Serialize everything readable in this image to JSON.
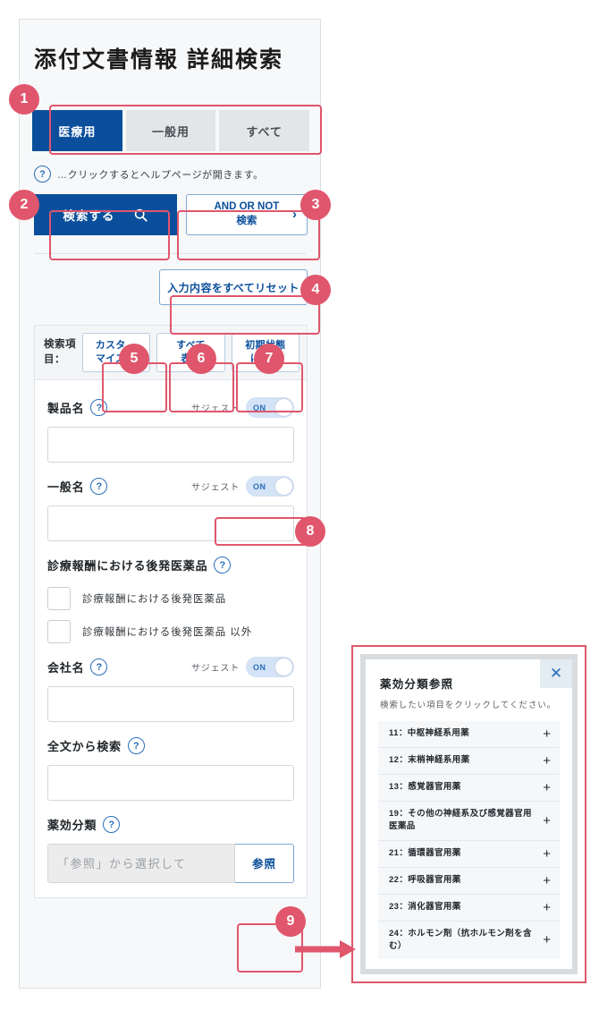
{
  "page": {
    "title": "添付文書情報 詳細検索"
  },
  "colors": {
    "primary_blue": "#0b4f9c",
    "annotation_red": "#e0566c",
    "toggle_track": "#d4e3f5",
    "panel_bg": "#f7f8f9"
  },
  "tabs": {
    "items": [
      {
        "label": "医療用",
        "active": true
      },
      {
        "label": "一般用",
        "active": false
      },
      {
        "label": "すべて",
        "active": false
      }
    ]
  },
  "hint": {
    "icon": "question-icon",
    "text": "…クリックするとヘルプページが開きます。"
  },
  "actions": {
    "search_label": "検索する",
    "search_icon": "search-icon",
    "andornot_line1": "AND OR NOT",
    "andornot_line2": "検索",
    "andornot_icon": "chevron-right-icon",
    "reset_label": "入力内容をすべてリセット"
  },
  "search_items": {
    "header_label": "検索項\n目：",
    "customize_label": "カスタ\nマイズ",
    "customize_icon": "external-link-icon",
    "show_all_label": "すべて\n表示",
    "restore_label": "初期状態\nに戻す"
  },
  "fields": {
    "product_name": {
      "label": "製品名",
      "suggest_label": "サジェスト",
      "toggle_state": "ON",
      "value": "",
      "placeholder": ""
    },
    "generic_name": {
      "label": "一般名",
      "suggest_label": "サジェスト",
      "toggle_state": "ON",
      "value": "",
      "placeholder": ""
    },
    "generic_drug": {
      "label": "診療報酬における後発医薬品",
      "checkbox_1": "診療報酬における後発医薬品",
      "checkbox_2": "診療報酬における後発医薬品 以外"
    },
    "company_name": {
      "label": "会社名",
      "suggest_label": "サジェスト",
      "toggle_state": "ON",
      "value": "",
      "placeholder": ""
    },
    "full_text": {
      "label": "全文から検索",
      "value": "",
      "placeholder": ""
    },
    "drug_class": {
      "label": "薬効分類",
      "input_placeholder": "「参照」から選択して",
      "ref_button_label": "参照"
    }
  },
  "modal": {
    "title": "薬効分類参照",
    "subtitle": "検索したい項目をクリックしてください。",
    "close_icon": "close-icon",
    "items": [
      {
        "label": "11：中枢神経系用薬",
        "expand": "+"
      },
      {
        "label": "12：末梢神経系用薬",
        "expand": "+"
      },
      {
        "label": "13：感覚器官用薬",
        "expand": "+"
      },
      {
        "label": "19：その他の神経系及び感覚器官用医薬品",
        "expand": "+"
      },
      {
        "label": "21：循環器官用薬",
        "expand": "+"
      },
      {
        "label": "22：呼吸器官用薬",
        "expand": "+"
      },
      {
        "label": "23：消化器官用薬",
        "expand": "+"
      },
      {
        "label": "24：ホルモン剤（抗ホルモン剤を含む）",
        "expand": "+"
      }
    ]
  },
  "annotations": {
    "badges": [
      {
        "number": "1"
      },
      {
        "number": "2"
      },
      {
        "number": "3"
      },
      {
        "number": "4"
      },
      {
        "number": "5"
      },
      {
        "number": "6"
      },
      {
        "number": "7"
      },
      {
        "number": "8"
      },
      {
        "number": "9"
      }
    ]
  }
}
